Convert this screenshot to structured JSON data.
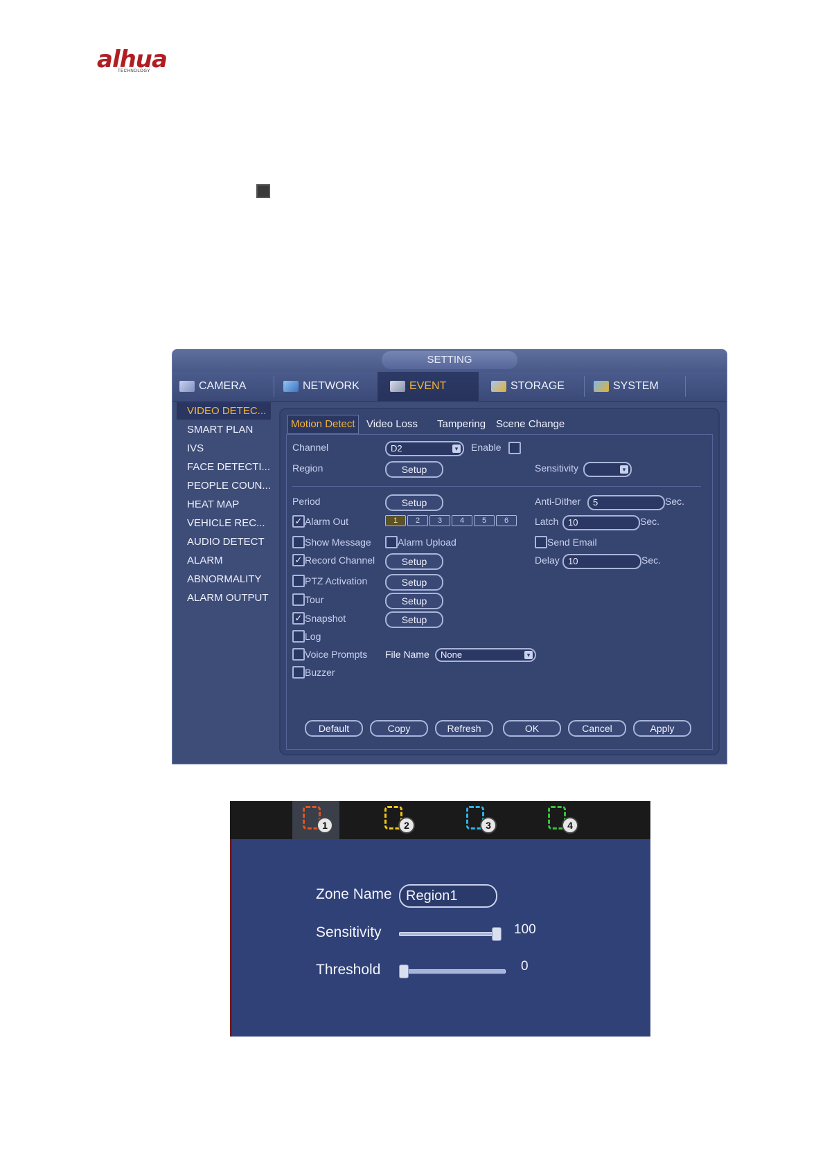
{
  "logo": {
    "brand": "alhua",
    "tagline": "TECHNOLOGY"
  },
  "window": {
    "title": "SETTING",
    "tabs": [
      {
        "label": "CAMERA",
        "icon": "camera-icon"
      },
      {
        "label": "NETWORK",
        "icon": "network-icon"
      },
      {
        "label": "EVENT",
        "icon": "event-icon",
        "active": true
      },
      {
        "label": "STORAGE",
        "icon": "storage-icon"
      },
      {
        "label": "SYSTEM",
        "icon": "system-icon"
      }
    ],
    "sidebar": [
      "VIDEO DETEC...",
      "SMART PLAN",
      "IVS",
      "FACE DETECTI...",
      "PEOPLE COUN...",
      "HEAT MAP",
      "VEHICLE REC...",
      "AUDIO DETECT",
      "ALARM",
      "ABNORMALITY",
      "ALARM OUTPUT"
    ],
    "subtabs": [
      "Motion Detect",
      "Video Loss",
      "Tampering",
      "Scene Change"
    ],
    "form": {
      "channel_label": "Channel",
      "channel_value": "D2",
      "enable_label": "Enable",
      "region_label": "Region",
      "setup": "Setup",
      "sensitivity_label": "Sensitivity",
      "sensitivity_value": "",
      "period_label": "Period",
      "anti_dither_label": "Anti-Dither",
      "anti_dither_value": "5",
      "sec": "Sec.",
      "alarm_out_label": "Alarm Out",
      "alarm_channels": [
        "1",
        "2",
        "3",
        "4",
        "5",
        "6"
      ],
      "latch_label": "Latch",
      "latch_value": "10",
      "show_message_label": "Show Message",
      "alarm_upload_label": "Alarm Upload",
      "send_email_label": "Send Email",
      "record_channel_label": "Record Channel",
      "delay_label": "Delay",
      "delay_value": "10",
      "ptz_label": "PTZ Activation",
      "tour_label": "Tour",
      "snapshot_label": "Snapshot",
      "log_label": "Log",
      "voice_label": "Voice Prompts",
      "file_name_label": "File Name",
      "file_name_value": "None",
      "buzzer_label": "Buzzer",
      "check_mark": "✓",
      "dropdown_arrow": "▾"
    },
    "buttons": [
      "Default",
      "Copy",
      "Refresh",
      "OK",
      "Cancel",
      "Apply"
    ]
  },
  "region_panel": {
    "zones": [
      {
        "num": "1",
        "color": "#e2541f"
      },
      {
        "num": "2",
        "color": "#f0c419"
      },
      {
        "num": "3",
        "color": "#2ab4e8"
      },
      {
        "num": "4",
        "color": "#37c43a"
      }
    ],
    "zone_name_label": "Zone Name",
    "zone_name_value": "Region1",
    "sensitivity_label": "Sensitivity",
    "sensitivity_value": "100",
    "threshold_label": "Threshold",
    "threshold_value": "0"
  }
}
